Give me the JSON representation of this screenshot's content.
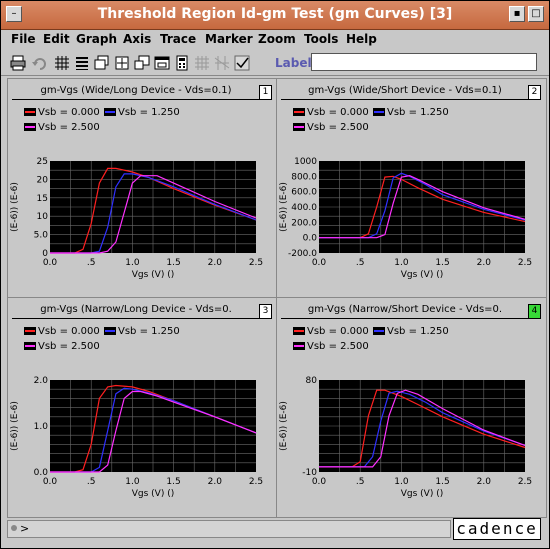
{
  "window": {
    "title": "Threshold Region Id-gm Test (gm Curves) [3]",
    "title_bg": "#c6693f"
  },
  "menu": [
    "File",
    "Edit",
    "Graph",
    "Axis",
    "Trace",
    "Marker",
    "Zoom",
    "Tools",
    "Help"
  ],
  "toolbar": {
    "icons": [
      "printer-icon",
      "undo-icon",
      "grid-icon",
      "list-icon",
      "window-stack-icon",
      "zoom-fit-icon",
      "new-window-icon",
      "subwindow-icon",
      "calculator-icon",
      "disabled-grid-icon",
      "disabled-grid2-icon",
      "check-icon"
    ],
    "label_text": "Label",
    "label_value": ""
  },
  "legend_entries": [
    {
      "text": "Vsb = 0.000",
      "color": "#ff2020"
    },
    {
      "text": "Vsb = 1.250",
      "color": "#3030ff"
    },
    {
      "text": "Vsb = 2.500",
      "color": "#ff30ff"
    }
  ],
  "status": {
    "prompt": ">"
  },
  "logo_text": "cadence",
  "chart_data": [
    {
      "type": "line",
      "title": "gm-Vgs (Wide/Long Device - Vds=0.1)",
      "panel_number": "1",
      "active": false,
      "xlabel": "Vgs (V) ()",
      "ylabel": "(E-6)) (E-6)",
      "xlim": [
        0,
        2.5
      ],
      "ylim": [
        0,
        25
      ],
      "xticks": [
        "0.0",
        ".5",
        "1.0",
        "1.5",
        "2.0",
        "2.5"
      ],
      "xtick_values": [
        0,
        0.5,
        1.0,
        1.5,
        2.0,
        2.5
      ],
      "yticks": [
        "0",
        "5.0",
        "10",
        "15",
        "20",
        "25"
      ],
      "ytick_values": [
        0,
        5,
        10,
        15,
        20,
        25
      ],
      "series": [
        {
          "name": "Vsb = 0.000",
          "color": "#ff2020",
          "x": [
            0,
            0.3,
            0.4,
            0.5,
            0.6,
            0.7,
            0.8,
            1.0,
            1.2,
            1.5,
            2.0,
            2.5
          ],
          "y": [
            0,
            0,
            1,
            8,
            19,
            23,
            23,
            22,
            20.5,
            17.5,
            13,
            9
          ]
        },
        {
          "name": "Vsb = 1.250",
          "color": "#3030ff",
          "x": [
            0,
            0.5,
            0.6,
            0.7,
            0.8,
            0.9,
            1.0,
            1.2,
            1.5,
            2.0,
            2.5
          ],
          "y": [
            0,
            0,
            0.5,
            7,
            18,
            21.5,
            21.5,
            20.5,
            18,
            13.2,
            9
          ]
        },
        {
          "name": "Vsb = 2.500",
          "color": "#ff30ff",
          "x": [
            0,
            0.6,
            0.7,
            0.8,
            0.9,
            1.0,
            1.1,
            1.3,
            1.5,
            2.0,
            2.5
          ],
          "y": [
            0,
            0,
            0.5,
            3,
            11,
            19,
            21,
            21,
            19,
            14,
            9.5
          ]
        }
      ]
    },
    {
      "type": "line",
      "title": "gm-Vgs (Wide/Short Device - Vds=0.1)",
      "panel_number": "2",
      "active": false,
      "xlabel": "Vgs (V) ()",
      "ylabel": "(E-6)) (E-6)",
      "xlim": [
        0,
        2.5
      ],
      "ylim": [
        -200,
        1000
      ],
      "xticks": [
        "0.0",
        ".5",
        "1.0",
        "1.5",
        "2.0",
        "2.5"
      ],
      "xtick_values": [
        0,
        0.5,
        1.0,
        1.5,
        2.0,
        2.5
      ],
      "yticks": [
        "-200.0",
        "0.0",
        "200.0",
        "400.0",
        "600.0",
        "800.0",
        "1000"
      ],
      "ytick_values": [
        -200,
        0,
        200,
        400,
        600,
        800,
        1000
      ],
      "series": [
        {
          "name": "Vsb = 0.000",
          "color": "#ff2020",
          "x": [
            0,
            0.5,
            0.6,
            0.7,
            0.8,
            0.9,
            1.0,
            1.2,
            1.5,
            2.0,
            2.5
          ],
          "y": [
            0,
            0,
            50,
            400,
            790,
            800,
            760,
            650,
            500,
            330,
            210
          ]
        },
        {
          "name": "Vsb = 1.250",
          "color": "#3030ff",
          "x": [
            0,
            0.6,
            0.7,
            0.8,
            0.9,
            1.0,
            1.1,
            1.3,
            1.5,
            2.0,
            2.5
          ],
          "y": [
            0,
            0,
            50,
            350,
            780,
            840,
            800,
            690,
            560,
            370,
            230
          ]
        },
        {
          "name": "Vsb = 2.500",
          "color": "#ff30ff",
          "x": [
            0,
            0.7,
            0.8,
            0.9,
            1.0,
            1.1,
            1.2,
            1.5,
            2.0,
            2.5
          ],
          "y": [
            0,
            0,
            40,
            450,
            790,
            810,
            760,
            600,
            390,
            240
          ]
        }
      ]
    },
    {
      "type": "line",
      "title": "gm-Vgs (Narrow/Long Device - Vds=0.",
      "panel_number": "3",
      "active": false,
      "xlabel": "Vgs (V) ()",
      "ylabel": "(E-6)) (E-6)",
      "xlim": [
        0,
        2.5
      ],
      "ylim": [
        0,
        2.0
      ],
      "xticks": [
        "0.0",
        ".5",
        "1.0",
        "1.5",
        "2.0",
        "2.5"
      ],
      "xtick_values": [
        0,
        0.5,
        1.0,
        1.5,
        2.0,
        2.5
      ],
      "yticks": [
        "0.0",
        "1.0",
        "2.0"
      ],
      "ytick_values": [
        0,
        1.0,
        2.0
      ],
      "series": [
        {
          "name": "Vsb = 0.000",
          "color": "#ff2020",
          "x": [
            0,
            0.3,
            0.4,
            0.5,
            0.6,
            0.7,
            0.8,
            1.0,
            1.2,
            1.5,
            2.0,
            2.5
          ],
          "y": [
            0,
            0,
            0.05,
            0.6,
            1.6,
            1.85,
            1.88,
            1.85,
            1.75,
            1.55,
            1.2,
            0.85
          ]
        },
        {
          "name": "Vsb = 1.250",
          "color": "#3030ff",
          "x": [
            0,
            0.5,
            0.6,
            0.7,
            0.8,
            0.9,
            1.0,
            1.2,
            1.5,
            2.0,
            2.5
          ],
          "y": [
            0,
            0,
            0.1,
            0.9,
            1.7,
            1.82,
            1.8,
            1.72,
            1.55,
            1.2,
            0.85
          ]
        },
        {
          "name": "Vsb = 2.500",
          "color": "#ff30ff",
          "x": [
            0,
            0.6,
            0.7,
            0.8,
            0.9,
            1.0,
            1.1,
            1.3,
            1.5,
            2.0,
            2.5
          ],
          "y": [
            0,
            0,
            0.15,
            0.9,
            1.6,
            1.75,
            1.75,
            1.65,
            1.52,
            1.2,
            0.85
          ]
        }
      ]
    },
    {
      "type": "line",
      "title": "gm-Vgs (Narrow/Short Device - Vds=0.",
      "panel_number": "4",
      "active": true,
      "xlabel": "Vgs (V) ()",
      "ylabel": "(E-6)) (E-6)",
      "xlim": [
        0,
        2.5
      ],
      "ylim": [
        -10,
        80
      ],
      "xticks": [
        "0.0",
        ".5",
        "1.0",
        "1.5",
        "2.0",
        "2.5"
      ],
      "xtick_values": [
        0,
        0.5,
        1.0,
        1.5,
        2.0,
        2.5
      ],
      "yticks": [
        "-10",
        "80"
      ],
      "ytick_values": [
        -10,
        80
      ],
      "series": [
        {
          "name": "Vsb = 0.000",
          "color": "#ff2020",
          "x": [
            0,
            0.4,
            0.5,
            0.6,
            0.7,
            0.8,
            1.0,
            1.2,
            1.5,
            2.0,
            2.5
          ],
          "y": [
            -5,
            -5,
            0,
            45,
            70,
            70,
            64,
            56,
            44,
            27,
            14
          ]
        },
        {
          "name": "Vsb = 1.250",
          "color": "#3030ff",
          "x": [
            0,
            0.55,
            0.65,
            0.75,
            0.85,
            0.95,
            1.1,
            1.3,
            1.5,
            2.0,
            2.5
          ],
          "y": [
            -5,
            -5,
            5,
            40,
            67,
            69,
            66,
            58,
            48,
            30,
            16
          ]
        },
        {
          "name": "Vsb = 2.500",
          "color": "#ff30ff",
          "x": [
            0,
            0.65,
            0.75,
            0.85,
            0.95,
            1.05,
            1.2,
            1.5,
            2.0,
            2.5
          ],
          "y": [
            -5,
            -5,
            5,
            45,
            67,
            70,
            66,
            52,
            31,
            16
          ]
        }
      ]
    }
  ]
}
